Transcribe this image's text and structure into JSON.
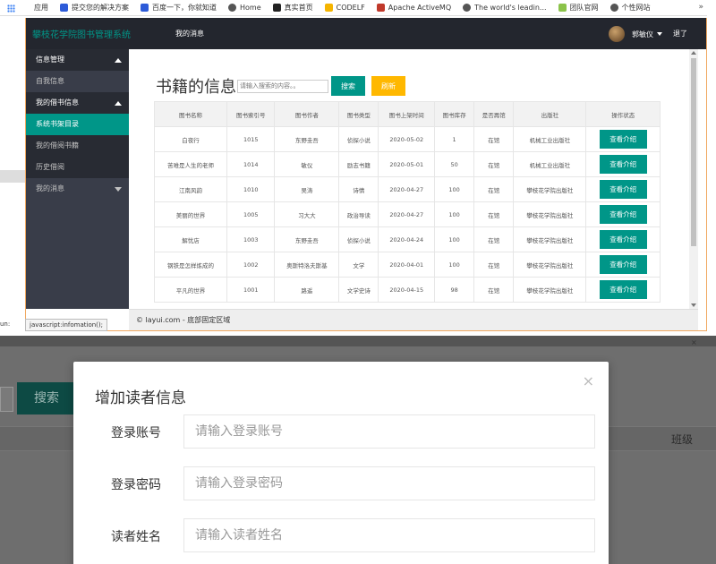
{
  "bookmarks": [
    {
      "label": "应用",
      "icon": "apps-icon",
      "color": "#4285f4"
    },
    {
      "label": "提交您的解决方案",
      "icon": "paw-icon",
      "color": "#2d5bd8"
    },
    {
      "label": "百度一下，你就知道",
      "icon": "paw-icon",
      "color": "#2d5bd8"
    },
    {
      "label": "Home",
      "icon": "globe-icon",
      "color": "#555555"
    },
    {
      "label": "真实首页",
      "icon": "dt-icon",
      "color": "#222222"
    },
    {
      "label": "CODELF",
      "icon": "codelf-icon",
      "color": "#f5b400"
    },
    {
      "label": "Apache ActiveMQ",
      "icon": "feather-icon",
      "color": "#c0392b"
    },
    {
      "label": "The world's leadin...",
      "icon": "globe-icon",
      "color": "#555555"
    },
    {
      "label": "团队官网",
      "icon": "leaf-icon",
      "color": "#8bc34a"
    },
    {
      "label": "个性网站",
      "icon": "globe-icon",
      "color": "#555555"
    }
  ],
  "bookmarks_more": "»",
  "header": {
    "logo": "攀枝花学院图书管理系统",
    "nav": "我的消息",
    "user_name": "郭敏仪",
    "logout": "退了"
  },
  "sidebar": {
    "items": [
      {
        "label": "信息管理",
        "kind": "group",
        "caret": "up"
      },
      {
        "label": "自我信息",
        "kind": "item"
      },
      {
        "label": "我的借书信息",
        "kind": "group",
        "caret": "up"
      },
      {
        "label": "系统书架目录",
        "kind": "active"
      },
      {
        "label": "我的借阅书籍",
        "kind": "sub"
      },
      {
        "label": "历史借阅",
        "kind": "sub"
      },
      {
        "label": "我的消息",
        "kind": "item",
        "caret": "down"
      }
    ]
  },
  "main": {
    "title": "书籍的信息",
    "search_placeholder": "请输入搜索的内容。。",
    "search_button": "搜索",
    "reset_button": "刷新"
  },
  "table": {
    "headers": [
      "图书名称",
      "图书索引号",
      "图书作者",
      "图书类型",
      "图书上架时间",
      "图书库存",
      "是否再馆",
      "出版社",
      "操作状态"
    ],
    "rows": [
      [
        "白夜行",
        "1015",
        "东野圭吾",
        "侦探小说",
        "2020-05-02",
        "1",
        "在馆",
        "机械工业出版社",
        "查看介绍"
      ],
      [
        "苦难是人生的老师",
        "1014",
        "敏仪",
        "励志书籍",
        "2020-05-01",
        "50",
        "在馆",
        "机械工业出版社",
        "查看介绍"
      ],
      [
        "江南风韵",
        "1010",
        "吴涛",
        "诗情",
        "2020-04-27",
        "100",
        "在馆",
        "攀枝花学院出版社",
        "查看介绍"
      ],
      [
        "美丽的世界",
        "1005",
        "习大大",
        "政治导读",
        "2020-04-27",
        "100",
        "在馆",
        "攀枝花学院出版社",
        "查看介绍"
      ],
      [
        "解忧店",
        "1003",
        "东野圭吾",
        "侦探小说",
        "2020-04-24",
        "100",
        "在馆",
        "攀枝花学院出版社",
        "查看介绍"
      ],
      [
        "钢铁是怎样炼成的",
        "1002",
        "奥斯特洛夫斯基",
        "文学",
        "2020-04-01",
        "100",
        "在馆",
        "攀枝花学院出版社",
        "查看介绍"
      ],
      [
        "平凡的世界",
        "1001",
        "路遥",
        "文学史诗",
        "2020-04-15",
        "98",
        "在馆",
        "攀枝花学院出版社",
        "查看介绍"
      ]
    ]
  },
  "footer": "© layui.com - 底部固定区域",
  "status_link": "javascript:infomation();",
  "status_left": "un:",
  "lower": {
    "search_button": "搜索",
    "column_header": "班级",
    "close": "×"
  },
  "modal": {
    "title": "增加读者信息",
    "close": "×",
    "fields": [
      {
        "label": "登录账号",
        "placeholder": "请输入登录账号"
      },
      {
        "label": "登录密码",
        "placeholder": "请输入登录密码"
      },
      {
        "label": "读者姓名",
        "placeholder": "请输入读者姓名"
      }
    ]
  },
  "colors": {
    "accent": "#009688",
    "warning": "#ffb800",
    "header_bg": "#23262e",
    "sidebar_bg": "#393d49"
  }
}
